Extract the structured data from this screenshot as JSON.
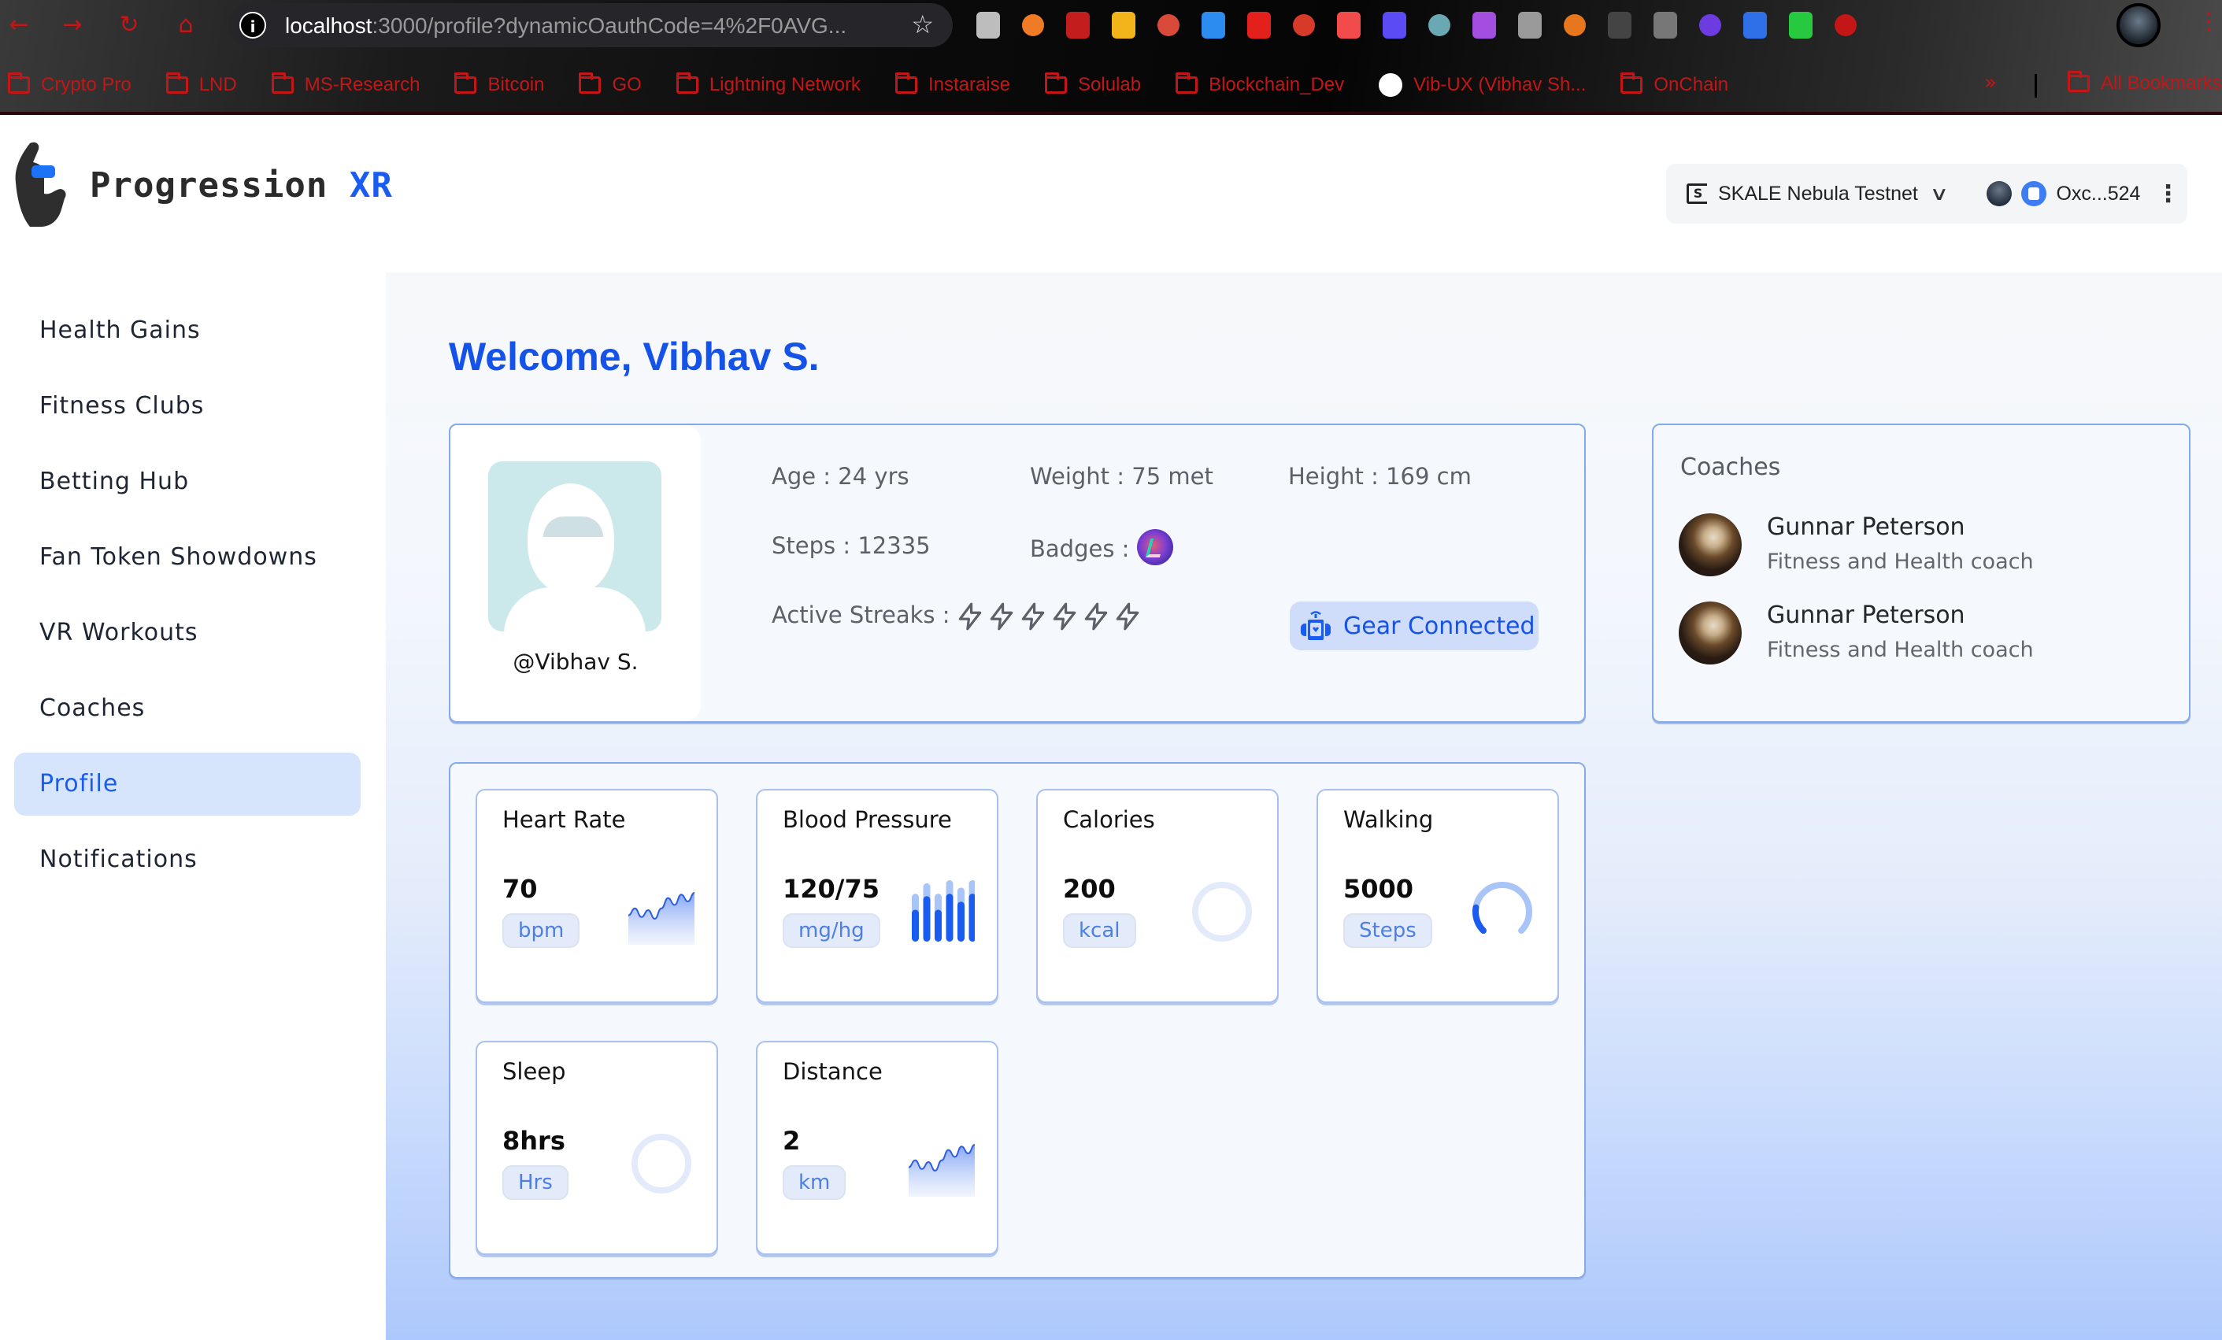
{
  "browser": {
    "url_host": "localhost",
    "url_rest": ":3000/profile?dynamicOauthCode=4%2F0AVG...",
    "bookmarks": [
      {
        "label": "Crypto Pro",
        "icon": "folder-icon"
      },
      {
        "label": "LND",
        "icon": "folder-icon"
      },
      {
        "label": "MS-Research",
        "icon": "folder-icon"
      },
      {
        "label": "Bitcoin",
        "icon": "folder-icon"
      },
      {
        "label": "GO",
        "icon": "folder-icon"
      },
      {
        "label": "Lightning Network",
        "icon": "folder-icon"
      },
      {
        "label": "Instaraise",
        "icon": "folder-icon"
      },
      {
        "label": "Solulab",
        "icon": "folder-icon"
      },
      {
        "label": "Blockchain_Dev",
        "icon": "folder-icon"
      },
      {
        "label": "Vib-UX (Vibhav Sh...",
        "icon": "github-icon"
      },
      {
        "label": "OnChain",
        "icon": "folder-icon"
      }
    ],
    "more_label": "»",
    "all_bookmarks_label": "All Bookmarks",
    "extension_colors": [
      "#bdbdbd",
      "#f07b26",
      "#c41d1d",
      "#f2b31b",
      "#d94a3a",
      "#2d8cf0",
      "#e3201b",
      "#d83a2a",
      "#f24b4b",
      "#5b4bf5",
      "#6aa9b3",
      "#a34ee0",
      "#9a9a9a",
      "#e8761c",
      "#444444",
      "#777777",
      "#6c3ce0",
      "#2f6fe8",
      "#27c93f",
      "#c41616"
    ]
  },
  "app": {
    "brand_main": "Progression ",
    "brand_accent": "XR",
    "wallet": {
      "network": "SKALE Nebula Testnet",
      "network_icon_letter": "S",
      "address": "Oxc...524"
    }
  },
  "sidebar": {
    "items": [
      {
        "label": "Health Gains",
        "active": false
      },
      {
        "label": "Fitness Clubs",
        "active": false
      },
      {
        "label": "Betting Hub",
        "active": false
      },
      {
        "label": "Fan Token Showdowns",
        "active": false
      },
      {
        "label": "VR Workouts",
        "active": false
      },
      {
        "label": "Coaches",
        "active": false
      },
      {
        "label": "Profile",
        "active": true
      },
      {
        "label": "Notifications",
        "active": false
      }
    ]
  },
  "main": {
    "welcome": "Welcome, Vibhav S.",
    "profile": {
      "handle": "@Vibhav S.",
      "age": "Age : 24 yrs",
      "weight": "Weight : 75 met",
      "height": "Height : 169 cm",
      "steps": "Steps : 12335",
      "badges_label": "Badges :",
      "badges_count": 1,
      "streaks_label": "Active Streaks :",
      "streaks_count": 6,
      "gear_status": "Gear Connected"
    },
    "coaches": {
      "title": "Coaches",
      "list": [
        {
          "name": "Gunnar Peterson",
          "role": "Fitness and Health coach"
        },
        {
          "name": "Gunnar Peterson",
          "role": "Fitness and Health coach"
        }
      ]
    },
    "metrics": [
      {
        "title": "Heart Rate",
        "value": "70",
        "unit": "bpm",
        "chart": "area"
      },
      {
        "title": "Blood Pressure",
        "value": "120/75",
        "unit": "mg/hg",
        "chart": "bars"
      },
      {
        "title": "Calories",
        "value": "200",
        "unit": "kcal",
        "chart": "ring",
        "progress": 0
      },
      {
        "title": "Walking",
        "value": "5000",
        "unit": "Steps",
        "chart": "ring",
        "progress": 0.2
      },
      {
        "title": "Sleep",
        "value": "8hrs",
        "unit": "Hrs",
        "chart": "ring",
        "progress": 0
      },
      {
        "title": "Distance",
        "value": "2",
        "unit": "km",
        "chart": "area"
      }
    ],
    "sparkline_values": [
      0.35,
      0.55,
      0.3,
      0.5,
      0.25,
      0.55,
      0.85,
      0.65,
      0.95,
      0.75,
      1.0
    ],
    "bp_bars": [
      {
        "total": 0.78,
        "fill": 0.52
      },
      {
        "total": 0.95,
        "fill": 0.74
      },
      {
        "total": 0.78,
        "fill": 0.52
      },
      {
        "total": 1.0,
        "fill": 0.78
      },
      {
        "total": 0.88,
        "fill": 0.65
      },
      {
        "total": 1.0,
        "fill": 0.78
      }
    ],
    "colors": {
      "accent": "#1a5cf0",
      "accent_light": "#a9c4f7",
      "ring_track": "#e3ebfb"
    }
  }
}
